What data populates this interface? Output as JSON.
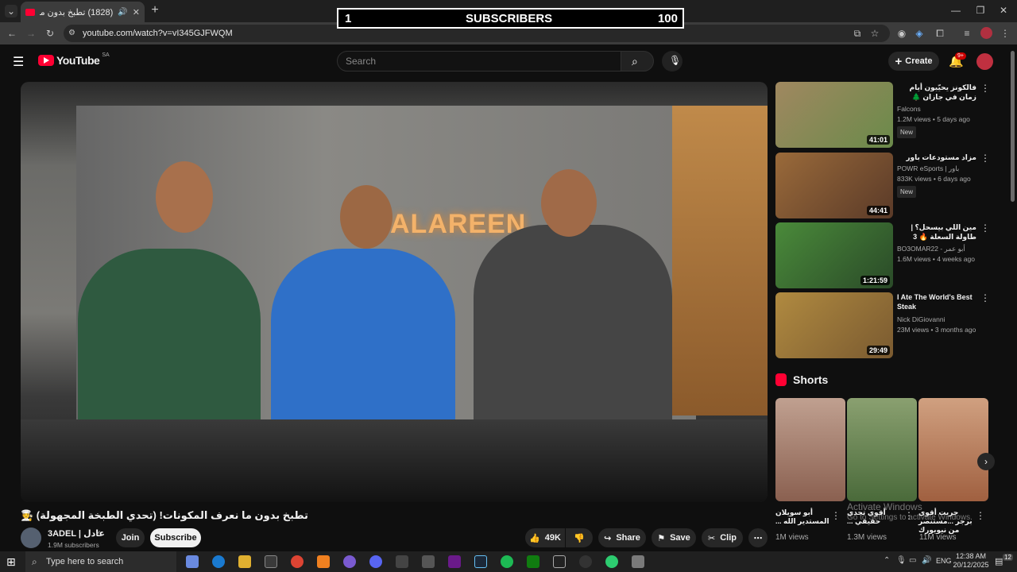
{
  "browser": {
    "tab_title": "(1828) تطبخ بدون ما نعرف ال...",
    "url": "youtube.com/watch?v=vI345GJFWQM"
  },
  "overlay": {
    "left_number": "1",
    "label": "SUBSCRIBERS",
    "right_number": "100"
  },
  "yt_header": {
    "logo_text": "YouTube",
    "region": "SA",
    "search_placeholder": "Search",
    "create_label": "Create",
    "notification_count": "9+"
  },
  "video": {
    "wall_logo": "ALAREEN",
    "title": "تطبخ بدون ما نعرف المكونات! (تحدي الطبخة المجهولة) 🧑‍🍳",
    "channel_name": "3ADEL | عادل",
    "subscribers": "1.9M subscribers",
    "join_label": "Join",
    "subscribe_label": "Subscribe",
    "likes": "49K",
    "share_label": "Share",
    "save_label": "Save",
    "clip_label": "Clip"
  },
  "recommendations": [
    {
      "title": "فالكونز يحيّيون أيام زمان في جازان 🌲",
      "channel": "Falcons",
      "meta": "1.2M views • 5 days ago",
      "badge": "New",
      "duration": "41:01",
      "color": "#8a9a6a"
    },
    {
      "title": "مزاد مستودعات باور",
      "channel": "POWR eSports | باور",
      "meta": "833K views • 6 days ago",
      "badge": "New",
      "duration": "44:41",
      "color": "#7a5030"
    },
    {
      "title": "مين اللي بيسحل؟ | طاولة السعلة 🔥 3",
      "channel": "BO3OMAR22 - أبو عمر",
      "meta": "1.6M views • 4 weeks ago",
      "badge": "",
      "duration": "1:21:59",
      "color": "#3a7a3a"
    },
    {
      "title": "I Ate The World's Best Steak",
      "channel": "Nick DiGiovanni",
      "meta": "23M views • 3 months ago",
      "badge": "",
      "duration": "29:49",
      "color": "#8a6a30"
    }
  ],
  "shorts": {
    "heading": "Shorts",
    "items": [
      {
        "title": "أبو سويلان المستدير الله ...",
        "views": "1M views",
        "color": "#b08070"
      },
      {
        "title": "أقوى تحدي حقيقي ...",
        "views": "1.3M views",
        "color": "#6a8a5a"
      },
      {
        "title": "جربت أقوى برجر ...مستنصر من نيويورك",
        "views": "11M views",
        "color": "#c09070"
      }
    ]
  },
  "windows_watermark": {
    "line1": "Activate Windows",
    "line2": "Go to Settings to activate Windows."
  },
  "taskbar": {
    "search_placeholder": "Type here to search",
    "language": "ENG",
    "time": "12:38 AM",
    "date": "20/12/2025",
    "notification_badge": "12"
  }
}
